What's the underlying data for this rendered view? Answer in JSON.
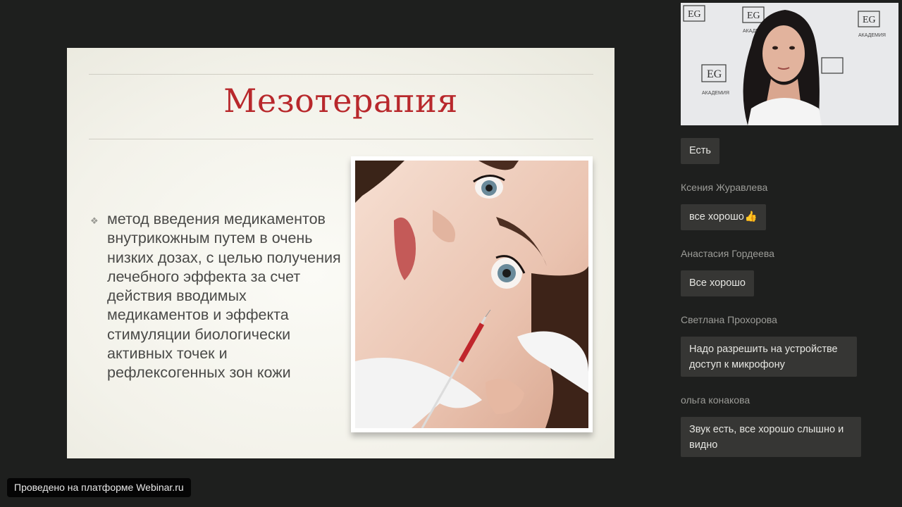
{
  "slide": {
    "title": "Мезотерапия",
    "bullet": "метод введения медикаментов внутрикожным путем в очень низких дозах, с целью получения лечебного эффекта за счет действия вводимых медикаментов и эффекта стимуляции биологически активных точек и рефлексогенных зон кожи",
    "bullet_marker": "❖",
    "title_color": "#b8282c"
  },
  "video": {
    "logo_text": "EG",
    "logo_caption": "АКАДЕМИЯ"
  },
  "chat": {
    "messages": [
      {
        "author": "",
        "text": "Есть"
      },
      {
        "author": "Ксения Журавлева",
        "text": "все хорошо",
        "emoji": "👍"
      },
      {
        "author": "Анастасия Гордеева",
        "text": "Все хорошо"
      },
      {
        "author": "Светлана Прохорова",
        "text": "Надо разрешить на устройстве доступ к микрофону"
      },
      {
        "author": "ольга конакова",
        "text": "Звук есть, все хорошо слышно и видно"
      }
    ]
  },
  "footer": {
    "badge": "Проведено на платформе Webinar.ru"
  }
}
